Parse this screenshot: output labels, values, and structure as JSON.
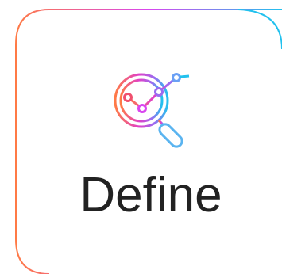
{
  "card": {
    "title": "Define",
    "icon": "magnifier-chart-icon",
    "colors": {
      "gradient_start": "#ff7a45",
      "gradient_mid": "#d946ef",
      "gradient_end": "#22c1ee",
      "text": "#222222"
    }
  }
}
